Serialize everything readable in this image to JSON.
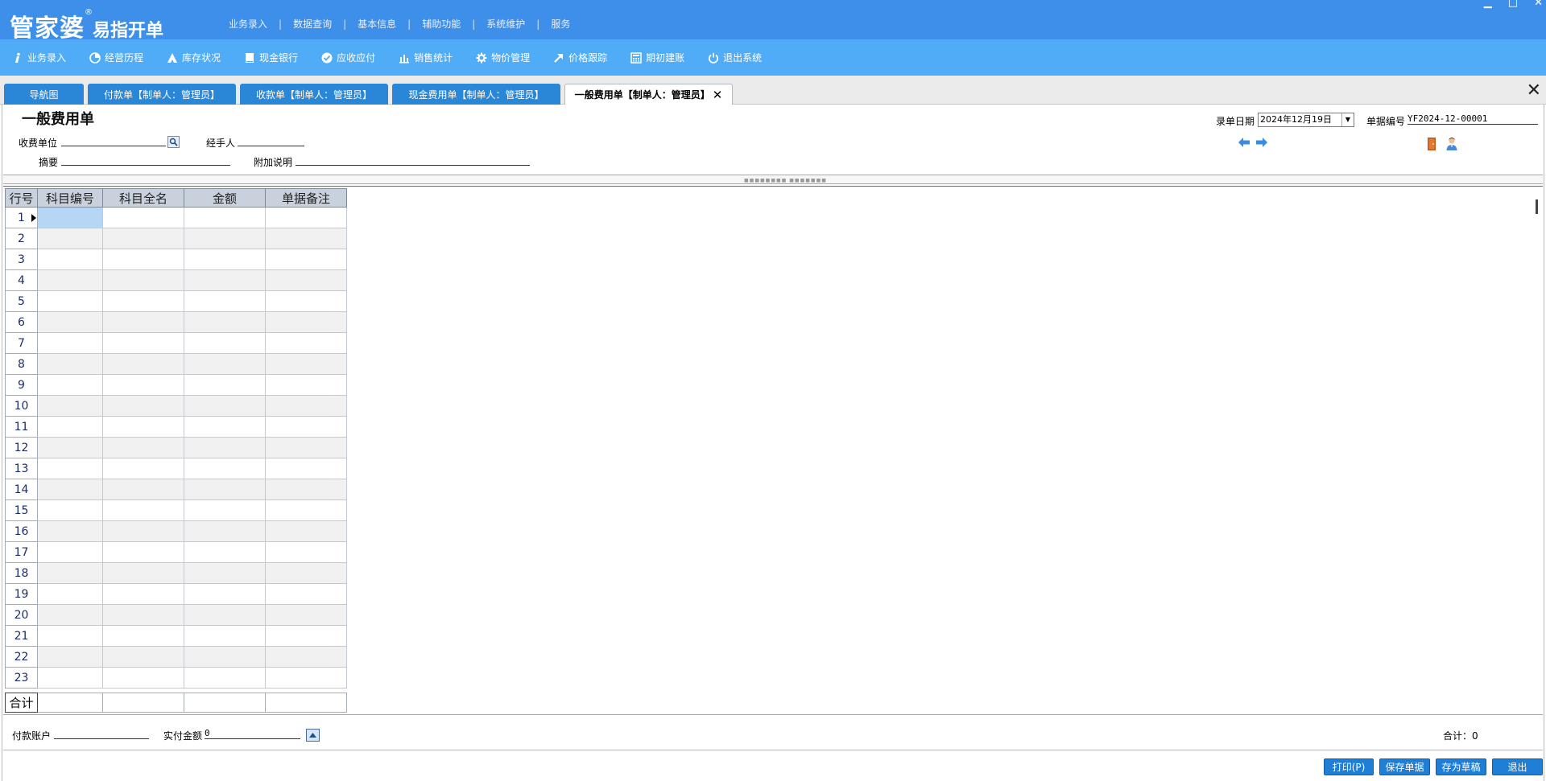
{
  "app": {
    "logo_main": "管家婆",
    "logo_reg": "®",
    "logo_sub": "易指开单"
  },
  "top_menu": [
    "业务录入",
    "数据查询",
    "基本信息",
    "辅助功能",
    "系统维护",
    "服务"
  ],
  "top_menu_sep": "|",
  "window_controls": {
    "minimize": "▁",
    "maximize": "□",
    "close": "✕"
  },
  "toolbar": [
    {
      "label": "业务录入",
      "icon": "info-icon"
    },
    {
      "label": "经营历程",
      "icon": "pie-chart-icon"
    },
    {
      "label": "库存状况",
      "icon": "warehouse-icon"
    },
    {
      "label": "现金银行",
      "icon": "book-icon"
    },
    {
      "label": "应收应付",
      "icon": "check-circle-icon"
    },
    {
      "label": "销售统计",
      "icon": "bar-chart-icon"
    },
    {
      "label": "物价管理",
      "icon": "gear-icon"
    },
    {
      "label": "价格跟踪",
      "icon": "arrow-up-right-icon"
    },
    {
      "label": "期初建账",
      "icon": "calculator-icon"
    },
    {
      "label": "退出系统",
      "icon": "power-icon"
    }
  ],
  "tabs": [
    {
      "label": "导航图",
      "active": false
    },
    {
      "label": "付款单【制单人：管理员】",
      "active": false
    },
    {
      "label": "收款单【制单人：管理员】",
      "active": false
    },
    {
      "label": "现金费用单【制单人：管理员】",
      "active": false
    },
    {
      "label": "一般费用单【制单人：管理员】",
      "active": true
    }
  ],
  "tab_close_glyph": "✕",
  "tabbar_close_glyph": "✕",
  "form": {
    "title": "一般费用单",
    "payee_label": "收费单位",
    "payee_value": "",
    "handler_label": "经手人",
    "handler_value": "",
    "summary_label": "摘要",
    "summary_value": "",
    "note_label": "附加说明",
    "note_value": "",
    "date_label": "录单日期",
    "date_value": "2024年12月19日",
    "docno_label": "单据编号",
    "docno_value": "YF2024-12-00001"
  },
  "grid": {
    "columns": [
      "行号",
      "科目编号",
      "科目全名",
      "金额",
      "单据备注"
    ],
    "rows": [
      "1",
      "2",
      "3",
      "4",
      "5",
      "6",
      "7",
      "8",
      "9",
      "10",
      "11",
      "12",
      "13",
      "14",
      "15",
      "16",
      "17",
      "18",
      "19",
      "20",
      "21",
      "22",
      "23"
    ],
    "total_label": "合计"
  },
  "footer": {
    "account_label": "付款账户",
    "account_value": "",
    "paid_label": "实付金额",
    "paid_value": "0",
    "sum_label": "合计：",
    "sum_value": "0"
  },
  "buttons": {
    "print": "打印(P)",
    "save": "保存单据",
    "draft": "存为草稿",
    "exit": "退出"
  },
  "colors": {
    "titlebar": "#3d8fea",
    "toolbar": "#50acf6",
    "tab": "#2a86d6",
    "button": "#1f7fd6",
    "selected_cell": "#b5d6f5"
  }
}
